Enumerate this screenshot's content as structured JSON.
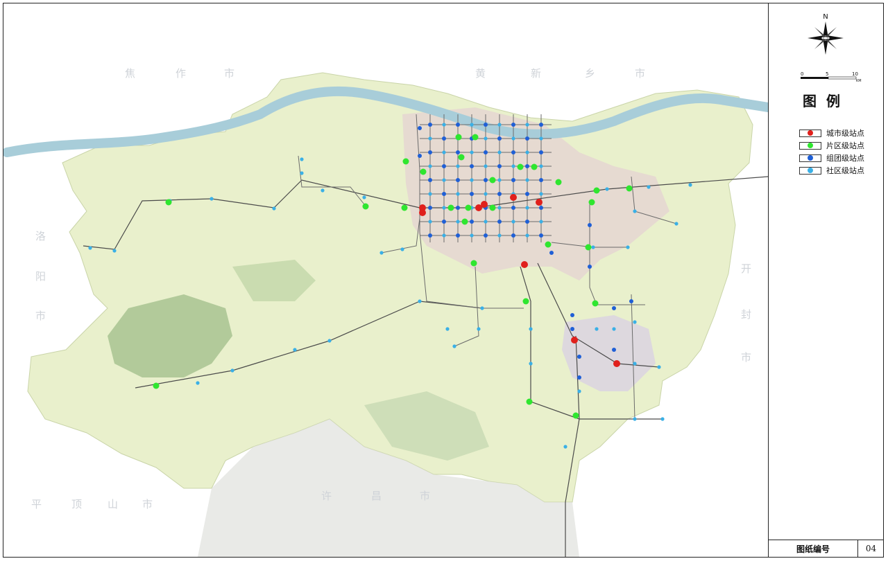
{
  "map": {
    "region_labels": [
      "焦",
      "作",
      "市",
      "黄",
      "新",
      "乡",
      "市",
      "洛",
      "阳",
      "市",
      "开",
      "封",
      "市",
      "平",
      "顶",
      "山",
      "市",
      "许",
      "昌",
      "市"
    ],
    "colors": {
      "city_station": "#e0201c",
      "district_station": "#2fe62f",
      "cluster_station": "#1f5fd6",
      "community_station": "#3ab0e6",
      "metro_line": "#6a6a6a",
      "rail_line": "#4a4a4a",
      "river": "#9fc7d6",
      "land_base": "#e8efc8",
      "mountain": "#9fbe8a"
    }
  },
  "north_arrow": {
    "label": "N",
    "icon": "compass-rose-icon"
  },
  "scale_bar": {
    "labels": [
      "0",
      "5",
      "10"
    ],
    "unit": "KM"
  },
  "legend": {
    "title": "图例",
    "items": [
      {
        "label": "城市级站点",
        "color": "#e0201c"
      },
      {
        "label": "片区级站点",
        "color": "#2fe62f"
      },
      {
        "label": "组团级站点",
        "color": "#1f5fd6"
      },
      {
        "label": "社区级站点",
        "color": "#3ab0e6"
      }
    ]
  },
  "footer": {
    "drawing_no_label": "图纸编号",
    "drawing_no": "04"
  }
}
